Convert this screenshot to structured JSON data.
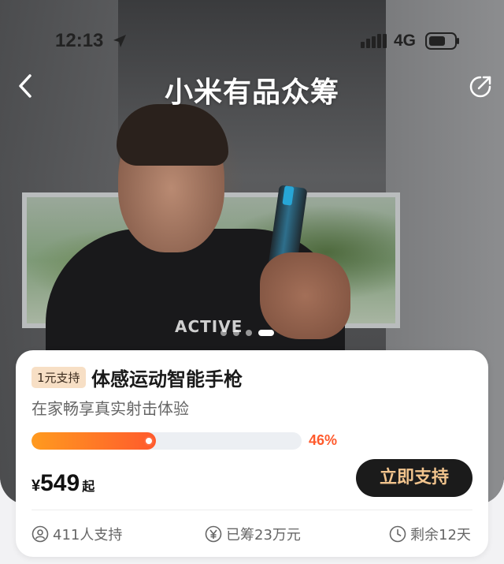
{
  "status_bar": {
    "time": "12:13",
    "network": "4G"
  },
  "header": {
    "title": "小米有品众筹"
  },
  "carousel": {
    "slide_count": 4,
    "active_index": 3
  },
  "hero": {
    "shirt_text": "ACTIVE"
  },
  "product": {
    "badge": "1元支持",
    "title": "体感运动智能手枪",
    "subtitle": "在家畅享真实射击体验",
    "progress_text": "46%",
    "progress_fraction": 0.46,
    "price_currency": "¥",
    "price_value": "549",
    "price_suffix": "起",
    "support_button": "立即支持"
  },
  "stats": {
    "supporters": "411人支持",
    "raised": "已筹23万元",
    "remaining": "剩余12天"
  },
  "colors": {
    "accent": "#ff5a2c",
    "button_bg": "#1b1b1b",
    "button_text": "#f2c48d",
    "badge_bg": "#f7dfc5"
  }
}
